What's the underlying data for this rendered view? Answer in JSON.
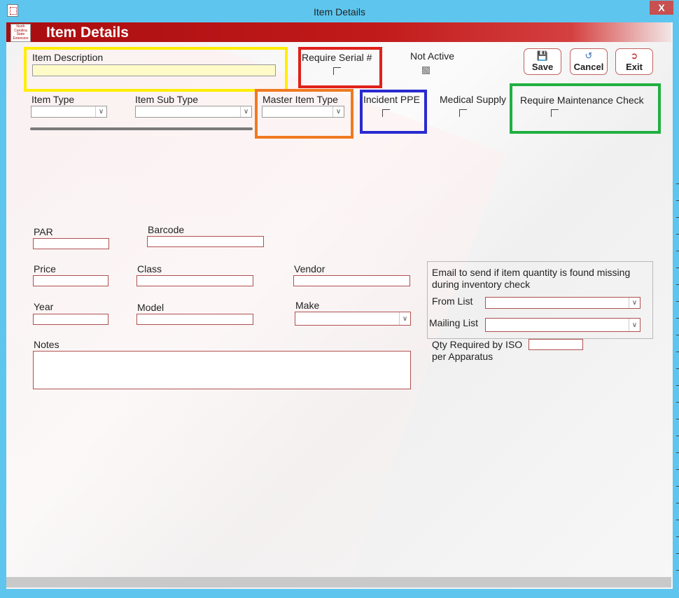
{
  "window": {
    "title": "Item Details",
    "close_label": "X"
  },
  "header": {
    "title": "Item Details",
    "logo_text": "North Carolina State Extension"
  },
  "toolbar": {
    "save_label": "Save",
    "cancel_label": "Cancel",
    "exit_label": "Exit"
  },
  "form": {
    "item_description": {
      "label": "Item Description",
      "value": ""
    },
    "require_serial": {
      "label": "Require Serial #",
      "checked": false
    },
    "not_active": {
      "label": "Not Active",
      "checked": false
    },
    "item_type": {
      "label": "Item Type",
      "value": ""
    },
    "item_sub_type": {
      "label": "Item Sub Type",
      "value": ""
    },
    "master_item_type": {
      "label": "Master Item Type",
      "value": ""
    },
    "incident_ppe": {
      "label": "Incident PPE",
      "checked": false
    },
    "medical_supply": {
      "label": "Medical Supply",
      "checked": false
    },
    "require_maintenance": {
      "label": "Require Maintenance Check",
      "checked": false
    },
    "par": {
      "label": "PAR",
      "value": ""
    },
    "barcode": {
      "label": "Barcode",
      "value": ""
    },
    "price": {
      "label": "Price",
      "value": ""
    },
    "class": {
      "label": "Class",
      "value": ""
    },
    "vendor": {
      "label": "Vendor",
      "value": ""
    },
    "year": {
      "label": "Year",
      "value": ""
    },
    "model": {
      "label": "Model",
      "value": ""
    },
    "make": {
      "label": "Make",
      "value": ""
    },
    "notes": {
      "label": "Notes",
      "value": ""
    },
    "email_group": {
      "heading": "Email to send if item quantity is found missing during inventory check",
      "from_list": {
        "label": "From List",
        "value": ""
      },
      "mailing_list": {
        "label": "Mailing List",
        "value": ""
      }
    },
    "qty_required": {
      "label": "Qty Required by ISO per Apparatus",
      "value": ""
    }
  },
  "highlights": {
    "yellow": "#ffee00",
    "red": "#e0201a",
    "orange": "#f07a20",
    "blue": "#2a2ad0",
    "green": "#20b040"
  }
}
